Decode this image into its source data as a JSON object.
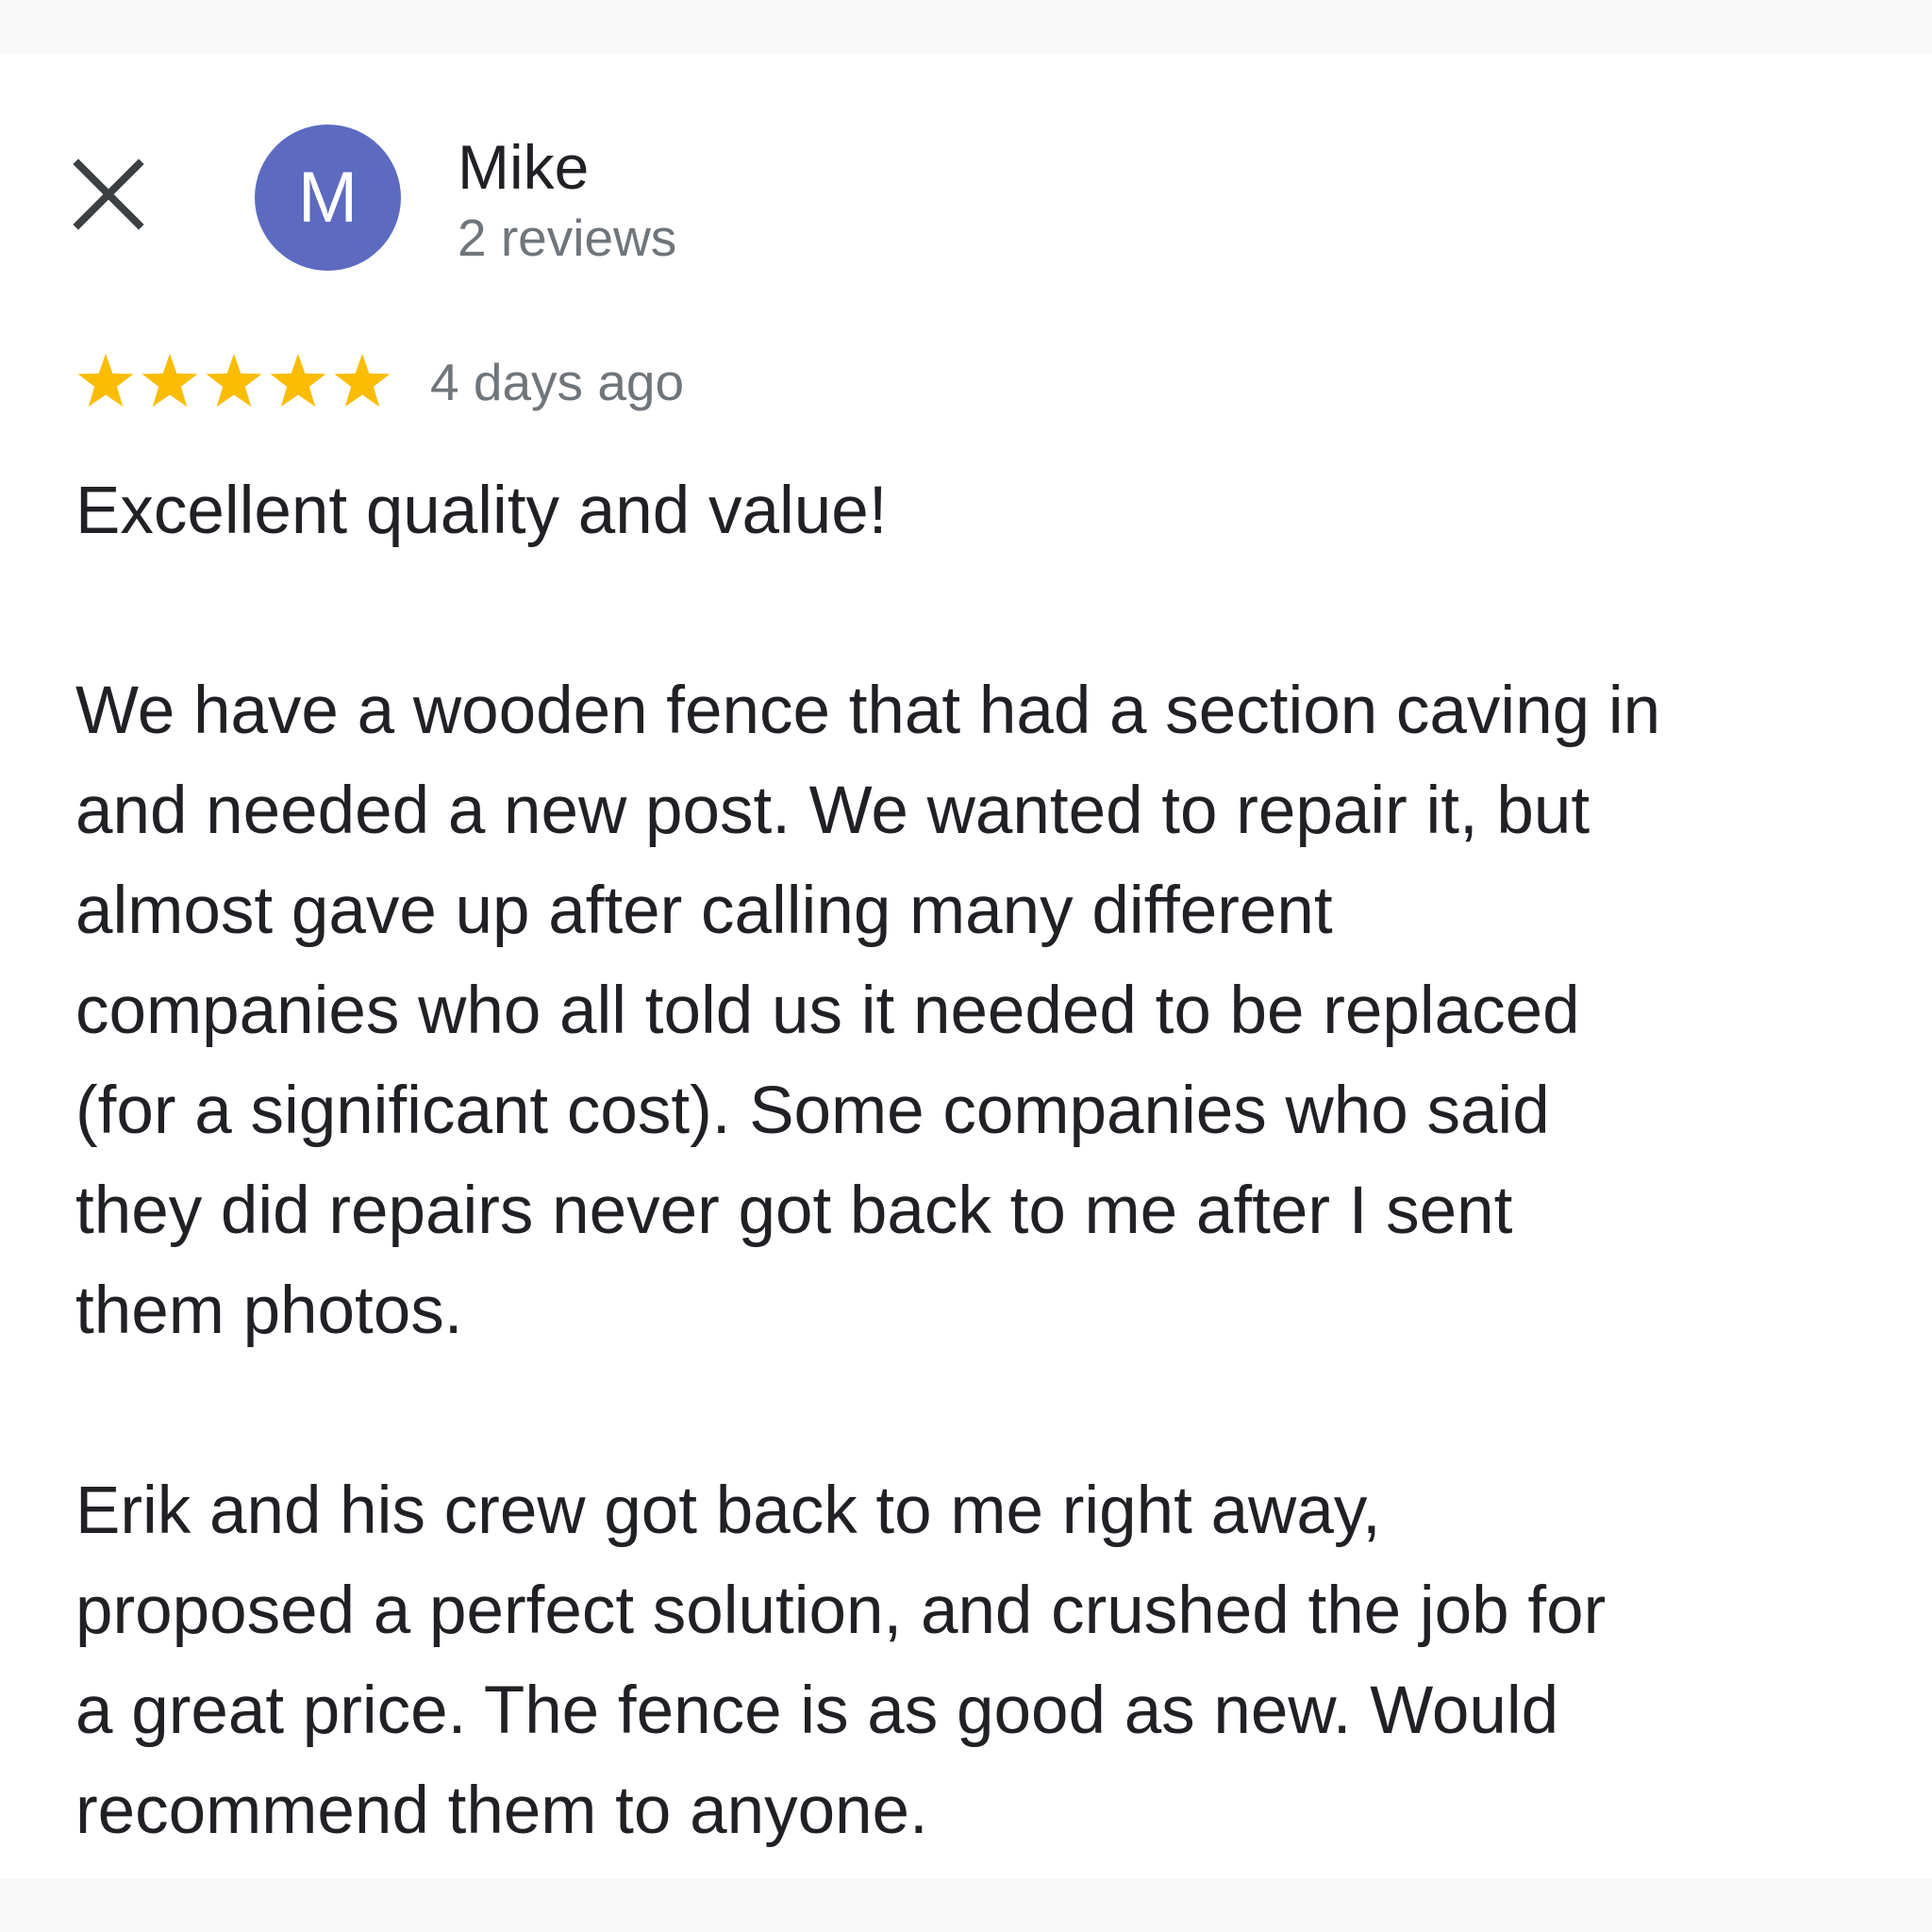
{
  "header": {
    "close_icon": "close-icon",
    "avatar_letter": "M",
    "avatar_color": "#5c6bc0",
    "author_name": "Mike",
    "review_count": "2 reviews"
  },
  "review": {
    "rating": 5,
    "rating_max": 5,
    "star_color": "#fbbc04",
    "time": "4 days ago",
    "paragraphs": [
      "Excellent quality and value!",
      "We have a wooden fence that had a section caving in\nand needed a new post. We wanted to repair it, but\nalmost gave up after calling many different\ncompanies who all told us it needed to be replaced\n(for a significant cost). Some companies who said\nthey did repairs never got back to me after I sent\nthem photos.",
      "Erik and his crew got back to me right away,\nproposed a perfect solution, and crushed the job for\na great price. The fence is as good as new. Would\nrecommend them to anyone."
    ]
  }
}
